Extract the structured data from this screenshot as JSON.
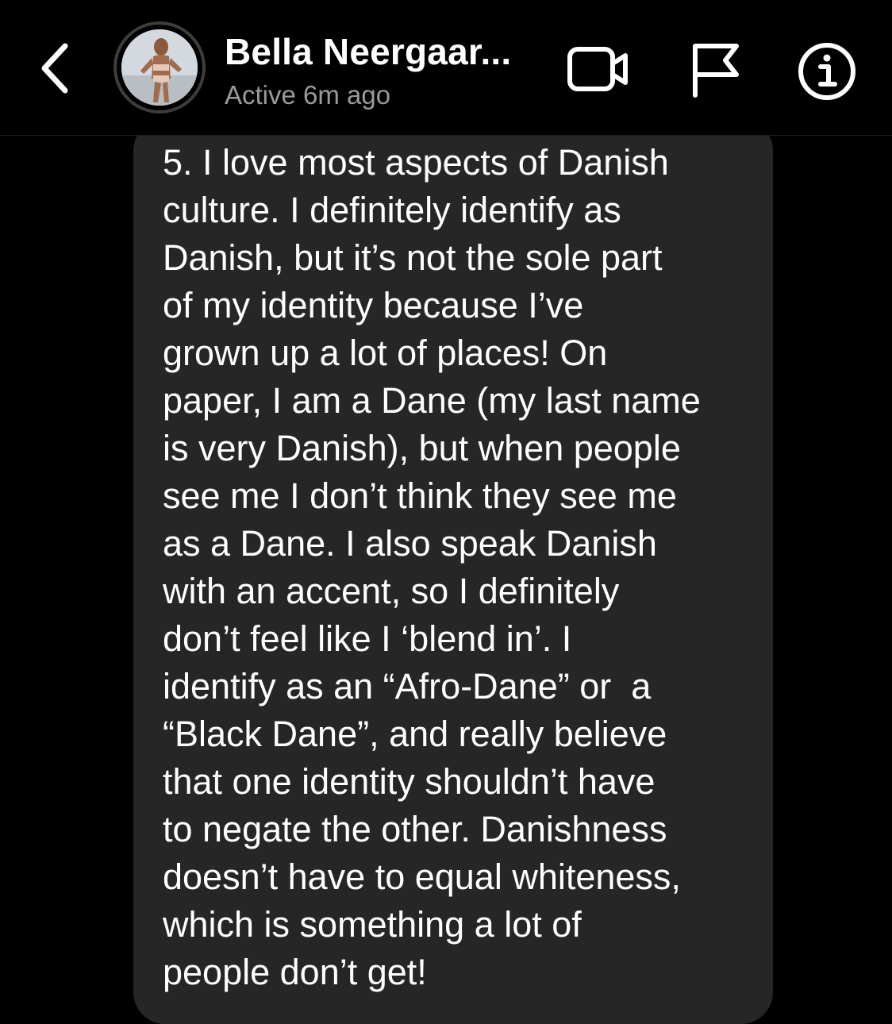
{
  "header": {
    "back_icon": "chevron-left-icon",
    "contact_name": "Bella Neergaar...",
    "status": "Active 6m ago",
    "video_icon": "video-camera-icon",
    "flag_icon": "flag-icon",
    "info_icon": "info-icon"
  },
  "message": {
    "text": "5. I love most aspects of Danish\nculture. I definitely identify as\nDanish, but it’s not the sole part\nof my identity because I’ve\ngrown up a lot of places! On\npaper, I am a Dane (my last name\nis very Danish), but when people\nsee me I don’t think they see me\nas a Dane. I also speak Danish\nwith an accent, so I definitely\ndon’t feel like I ‘blend in’. I\nidentify as an “Afro-Dane” or  a\n“Black Dane”, and really believe\nthat one identity shouldn’t have\nto negate the other. Danishness\ndoesn’t have to equal whiteness,\nwhich is something a lot of\npeople don’t get!"
  },
  "colors": {
    "background": "#000000",
    "bubble": "#262626",
    "text": "#ffffff",
    "status_text": "#9a9a9a"
  }
}
